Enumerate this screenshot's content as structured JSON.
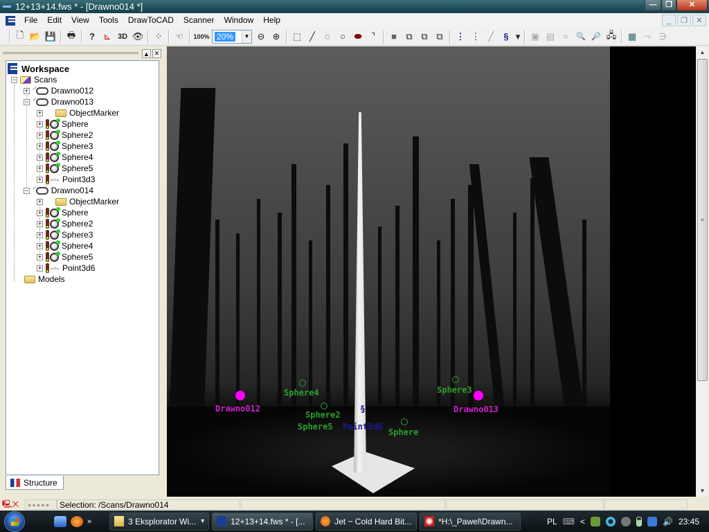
{
  "window": {
    "title": "12+13+14.fws * - [Drawno014 *]",
    "controls": {
      "minimize": "—",
      "maximize": "❐",
      "close": "✕"
    }
  },
  "menu": {
    "items": [
      "File",
      "Edit",
      "View",
      "Tools",
      "DrawToCAD",
      "Scanner",
      "Window",
      "Help"
    ],
    "mdi_controls": {
      "minimize": "_",
      "restore": "❐",
      "close": "✕"
    }
  },
  "toolbar": {
    "buttons": [
      {
        "name": "new-icon",
        "glyph": "🗋"
      },
      {
        "name": "open-icon",
        "glyph": "📂"
      },
      {
        "name": "save-icon",
        "glyph": "💾"
      },
      {
        "name": "print-icon",
        "glyph": "🖶"
      },
      {
        "name": "help-icon",
        "glyph": "?"
      },
      {
        "name": "axes-icon",
        "glyph": "⊾"
      },
      {
        "name": "3d-icon",
        "glyph": "3D"
      },
      {
        "name": "eye-icon",
        "glyph": "👁"
      },
      {
        "name": "points-icon",
        "glyph": "⁘"
      },
      {
        "name": "pan-hand-icon",
        "glyph": "☜"
      },
      {
        "name": "zoom-100-icon",
        "glyph": "100%"
      }
    ],
    "zoom_value": "20%",
    "buttons_right": [
      {
        "name": "zoom-out-icon",
        "glyph": "⊖"
      },
      {
        "name": "zoom-in-icon",
        "glyph": "⊕"
      },
      {
        "name": "rect-select-icon",
        "glyph": "⬚"
      },
      {
        "name": "line-icon",
        "glyph": "╱"
      },
      {
        "name": "lasso-icon",
        "glyph": "◌"
      },
      {
        "name": "circle-select-icon",
        "glyph": "○"
      },
      {
        "name": "brush-icon",
        "glyph": "⬬"
      },
      {
        "name": "corner-icon",
        "glyph": "⌝"
      },
      {
        "name": "box-icon",
        "glyph": "■"
      },
      {
        "name": "boxes-union-icon",
        "glyph": "⧉"
      },
      {
        "name": "boxes-diff-icon",
        "glyph": "⧉"
      },
      {
        "name": "boxes-intersect-icon",
        "glyph": "⧉"
      },
      {
        "name": "list-dots-icon",
        "glyph": "⋮"
      },
      {
        "name": "list-bracket-icon",
        "glyph": "⋮"
      },
      {
        "name": "pen-icon",
        "glyph": "╱"
      },
      {
        "name": "pin-icon",
        "glyph": "§"
      },
      {
        "name": "pin-dropdown-icon",
        "glyph": "▾"
      },
      {
        "name": "scan-camera-icon",
        "glyph": "▣"
      },
      {
        "name": "scan-frame-icon",
        "glyph": "▤"
      },
      {
        "name": "scan-mesh-icon",
        "glyph": "⌗"
      },
      {
        "name": "scan-search-icon",
        "glyph": "🔍"
      },
      {
        "name": "window-search-icon",
        "glyph": "🔎"
      },
      {
        "name": "network-icon",
        "glyph": "🖧"
      },
      {
        "name": "register-icon",
        "glyph": "▦"
      },
      {
        "name": "link-icon",
        "glyph": "⤳"
      },
      {
        "name": "unlink-icon",
        "glyph": "∋"
      }
    ]
  },
  "workspace": {
    "panel_controls": {
      "up": "▲",
      "close": "✕"
    },
    "root": "Workspace",
    "tree": [
      {
        "label": "Scans",
        "type": "scans-folder",
        "level": 1,
        "expander": "−"
      },
      {
        "label": "Drawno012",
        "type": "scan",
        "level": 2,
        "expander": "+",
        "checked": true
      },
      {
        "label": "Drawno013",
        "type": "scan",
        "level": 2,
        "expander": "−",
        "checked": true
      },
      {
        "label": "ObjectMarker",
        "type": "folder",
        "level": 3,
        "expander": "+"
      },
      {
        "label": "Sphere",
        "type": "sphere",
        "level": 3,
        "expander": "+"
      },
      {
        "label": "Sphere2",
        "type": "sphere",
        "level": 3,
        "expander": "+"
      },
      {
        "label": "Sphere3",
        "type": "sphere",
        "level": 3,
        "expander": "+"
      },
      {
        "label": "Sphere4",
        "type": "sphere",
        "level": 3,
        "expander": "+"
      },
      {
        "label": "Sphere5",
        "type": "sphere",
        "level": 3,
        "expander": "+"
      },
      {
        "label": "Point3d3",
        "type": "point",
        "level": 3,
        "expander": "+"
      },
      {
        "label": "Drawno014",
        "type": "scan",
        "level": 2,
        "expander": "−",
        "checked": true
      },
      {
        "label": "ObjectMarker",
        "type": "folder",
        "level": 3,
        "expander": "+"
      },
      {
        "label": "Sphere",
        "type": "sphere",
        "level": 3,
        "expander": "+"
      },
      {
        "label": "Sphere2",
        "type": "sphere",
        "level": 3,
        "expander": "+"
      },
      {
        "label": "Sphere3",
        "type": "sphere",
        "level": 3,
        "expander": "+"
      },
      {
        "label": "Sphere4",
        "type": "sphere",
        "level": 3,
        "expander": "+"
      },
      {
        "label": "Sphere5",
        "type": "sphere",
        "level": 3,
        "expander": "+"
      },
      {
        "label": "Point3d6",
        "type": "point",
        "level": 3,
        "expander": "+"
      },
      {
        "label": "Models",
        "type": "folder",
        "level": 1,
        "expander": ""
      }
    ],
    "tab_label": "Structure"
  },
  "viewport": {
    "colors": {
      "scan_marker": "#ff00ff",
      "sphere_label": "#2ca02c",
      "point_label": "#1a1a9a"
    },
    "labels": {
      "drawno012": "Drawno012",
      "drawno013": "Drawno013",
      "sphere": "Sphere",
      "sphere2": "Sphere2",
      "sphere3": "Sphere3",
      "sphere4": "Sphere4",
      "sphere5": "Sphere5",
      "point": "Point3d6"
    },
    "scrollbar": {
      "up": "▲",
      "down": "▼",
      "grip": "≡"
    }
  },
  "statusbar": {
    "icons": "🖳✕",
    "progress_dots": "●●●●●",
    "selection": "Selection: /Scans/Drawno014"
  },
  "taskbar": {
    "overflow": "»",
    "tasks": [
      {
        "label": "3 Eksplorator Wi...",
        "has_dropdown": true,
        "dropdown": "▾"
      },
      {
        "label": "12+13+14.fws * - [...",
        "active": true
      },
      {
        "label": "Jet ~ Cold Hard Bit..."
      },
      {
        "label": "*H:\\_Pawel\\Drawn..."
      }
    ],
    "tray": {
      "language": "PL",
      "keyboard": "⌨",
      "expand": "<",
      "clock": "23:45"
    }
  }
}
